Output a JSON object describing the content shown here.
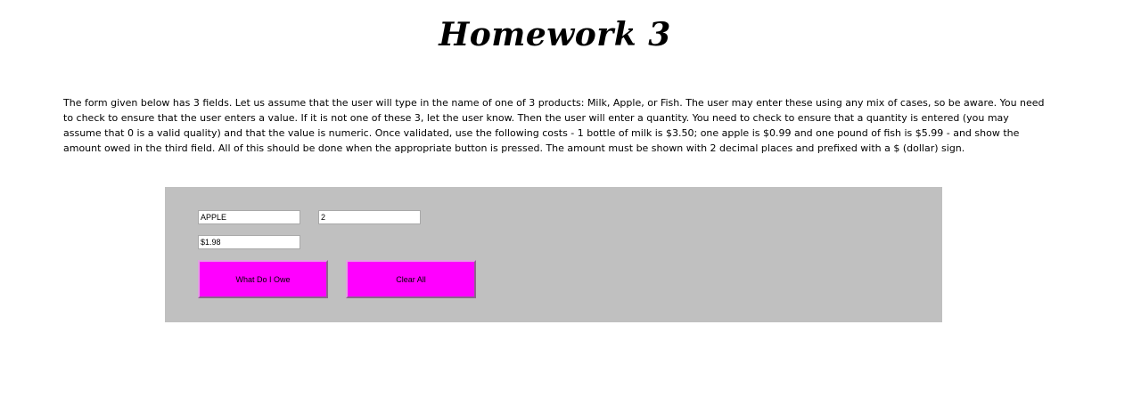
{
  "page": {
    "title": "Homework 3",
    "description": "The form given below has 3 fields. Let us assume that the user will type in the name of one of 3 products: Milk, Apple, or Fish. The user may enter these using any mix of cases, so be aware. You need to check to ensure that the user enters a value. If it is not one of these 3, let the user know. Then the user will enter a quantity. You need to check to ensure that a quantity is entered (you may assume that 0 is a valid quality) and that the value is numeric. Once validated, use the following costs - 1 bottle of milk is $3.50; one apple is $0.99 and one pound of fish is $5.99 - and show the amount owed in the third field. All of this should be done when the appropriate button is pressed. The amount must be shown with 2 decimal places and prefixed with a $ (dollar) sign."
  },
  "form": {
    "product_value": "APPLE",
    "quantity_value": "2",
    "amount_value": "$1.98",
    "owe_button_label": "What Do I Owe",
    "clear_button_label": "Clear All"
  },
  "colors": {
    "panel_background": "#c0c0c0",
    "button_background": "#ff00ff"
  }
}
